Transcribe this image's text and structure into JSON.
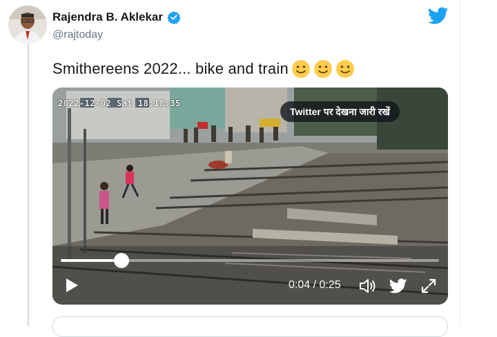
{
  "tweet": {
    "author_name": "Rajendra B. Aklekar",
    "handle": "@rajtoday",
    "text": "Smithereens 2022... bike and train",
    "emojis": [
      "slightly-smiling-face-icon",
      "slightly-smiling-face-icon",
      "slightly-smiling-face-icon"
    ],
    "verified": true
  },
  "video": {
    "cctv_timestamp": "2022-12-02 Sat 18:18:35",
    "watch_on_twitter_label": "Twitter पर देखना जारी रखें",
    "current_time": "0:04",
    "duration": "0:25",
    "time_separator": " / ",
    "progress_fraction": 0.16
  },
  "icons": {
    "brand": "twitter-bird-icon",
    "verified": "verified-badge-icon",
    "play": "play-icon",
    "volume": "volume-icon",
    "fullscreen": "fullscreen-icon"
  },
  "colors": {
    "twitter_blue": "#1da1f2",
    "name_text": "#14171a",
    "secondary_text": "#657786"
  }
}
